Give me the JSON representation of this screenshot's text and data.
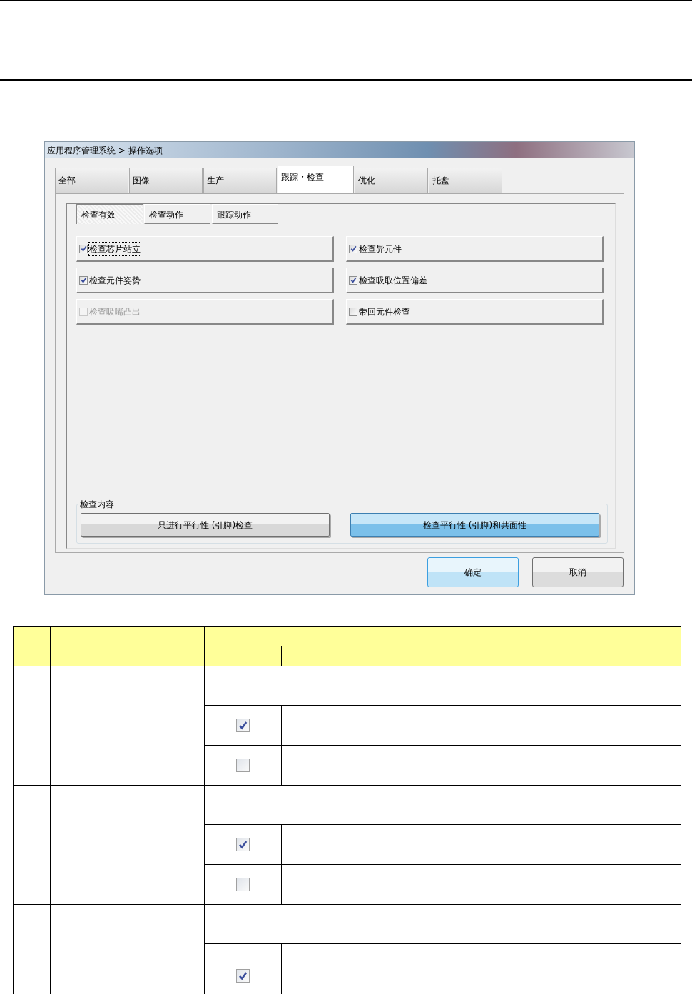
{
  "window": {
    "title": "应用程序管理系统 > 操作选项"
  },
  "tabs": [
    {
      "label": "全部",
      "selected": false
    },
    {
      "label": "图像",
      "selected": false
    },
    {
      "label": "生产",
      "selected": false
    },
    {
      "label": "跟踪・检查",
      "selected": true
    },
    {
      "label": "优化",
      "selected": false
    },
    {
      "label": "托盘",
      "selected": false
    }
  ],
  "subtabs": [
    {
      "label": "检查有效",
      "selected": true
    },
    {
      "label": "检查动作",
      "selected": false
    },
    {
      "label": "跟踪动作",
      "selected": false
    }
  ],
  "options": [
    {
      "label": "检查芯片站立",
      "checked": true,
      "disabled": false,
      "focused": true
    },
    {
      "label": "检查异元件",
      "checked": true,
      "disabled": false,
      "focused": false
    },
    {
      "label": "检查元件姿势",
      "checked": true,
      "disabled": false,
      "focused": false
    },
    {
      "label": "检查吸取位置偏差",
      "checked": true,
      "disabled": false,
      "focused": false
    },
    {
      "label": "检查吸嘴凸出",
      "checked": false,
      "disabled": true,
      "focused": false
    },
    {
      "label": "带回元件检查",
      "checked": false,
      "disabled": false,
      "focused": false
    }
  ],
  "check_content": {
    "label": "检查内容",
    "options": [
      {
        "label": "只进行平行性 (引脚)检查",
        "selected": false
      },
      {
        "label": "检查平行性 (引脚)和共面性",
        "selected": true
      }
    ]
  },
  "buttons": [
    {
      "label": "确定",
      "kind": "default"
    },
    {
      "label": "取消",
      "kind": "normal"
    }
  ],
  "table": {
    "groups": [
      {
        "rows": [
          {
            "checked": true
          },
          {
            "checked": false
          }
        ]
      },
      {
        "rows": [
          {
            "checked": true
          },
          {
            "checked": false
          }
        ]
      },
      {
        "rows": [
          {
            "checked": true
          }
        ]
      }
    ]
  }
}
